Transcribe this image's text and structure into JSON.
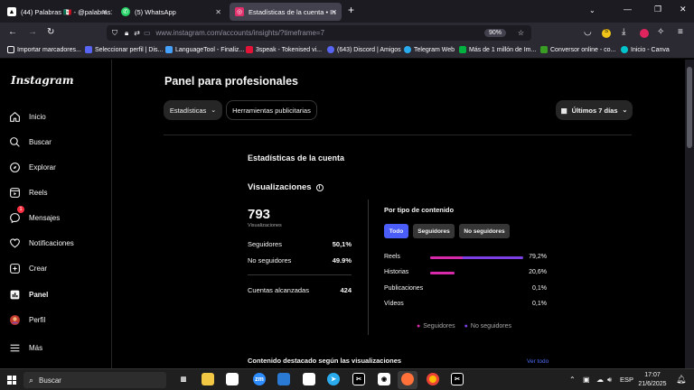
{
  "browser": {
    "tabs": [
      {
        "title": "(44) Palabras 🇲🇽 - @palabras1 |",
        "active": false
      },
      {
        "title": "(5) WhatsApp",
        "active": false
      },
      {
        "title": "Estadísticas de la cuenta • Insta",
        "active": true
      }
    ],
    "new_tab": "+",
    "url": "www.instagram.com/accounts/insights/?timeframe=7",
    "zoom": "90%",
    "bookmarks": [
      "Importar marcadores...",
      "Seleccionar perfil | Dis...",
      "LanguageTool - Finaliz...",
      "3speak - Tokenised vi...",
      "(643) Discord | Amigos",
      "Telegram Web",
      "Más de 1 millón de Im...",
      "Conversor online - co...",
      "Inicio - Canva"
    ]
  },
  "sidebar": {
    "logo": "Instagram",
    "items": [
      {
        "label": "Inicio",
        "icon": "home-icon"
      },
      {
        "label": "Buscar",
        "icon": "search-icon"
      },
      {
        "label": "Explorar",
        "icon": "explore-icon"
      },
      {
        "label": "Reels",
        "icon": "reels-icon"
      },
      {
        "label": "Mensajes",
        "icon": "messenger-icon",
        "badge": "1"
      },
      {
        "label": "Notificaciones",
        "icon": "heart-icon"
      },
      {
        "label": "Crear",
        "icon": "plus-square-icon"
      },
      {
        "label": "Panel",
        "icon": "dashboard-icon"
      },
      {
        "label": "Perfil",
        "icon": "avatar-icon"
      },
      {
        "label": "Más",
        "icon": "menu-icon"
      }
    ]
  },
  "main": {
    "title": "Panel para profesionales",
    "filters": {
      "stats": "Estadísticas",
      "tools": "Herramientas publicitarias",
      "range": "Últimos 7 días"
    },
    "section_title": "Estadísticas de la cuenta",
    "views_title": "Visualizaciones",
    "views_total": "793",
    "views_label": "Visualizaciones",
    "rows": [
      {
        "label": "Seguidores",
        "value": "50,1%"
      },
      {
        "label": "No seguidores",
        "value": "49.9%"
      },
      {
        "label": "Cuentas alcanzadas",
        "value": "424"
      }
    ],
    "content_type": {
      "title": "Por tipo de contenido",
      "tabs": [
        "Todo",
        "Seguidores",
        "No seguidores"
      ],
      "items": [
        {
          "label": "Reels",
          "value": "79,2%",
          "followers": 0.28,
          "total": 0.792
        },
        {
          "label": "Historias",
          "value": "20,6%",
          "followers": 0.206,
          "total": 0.206
        },
        {
          "label": "Publicaciones",
          "value": "0,1%",
          "followers": 0,
          "total": 0
        },
        {
          "label": "Vídeos",
          "value": "0,1%",
          "followers": 0,
          "total": 0
        }
      ],
      "legend": [
        "Seguidores",
        "No seguidores"
      ]
    },
    "featured_title": "Contenido destacado según las visualizaciones",
    "see_all": "Ver todo"
  },
  "colors": {
    "followers": "#d62aa8",
    "non_followers": "#7b3fe4",
    "accent": "#4a5df9",
    "link": "#4a6cf7"
  },
  "taskbar": {
    "search_placeholder": "Buscar",
    "lang": "ESP",
    "time": "17:07",
    "date": "21/6/2025"
  }
}
